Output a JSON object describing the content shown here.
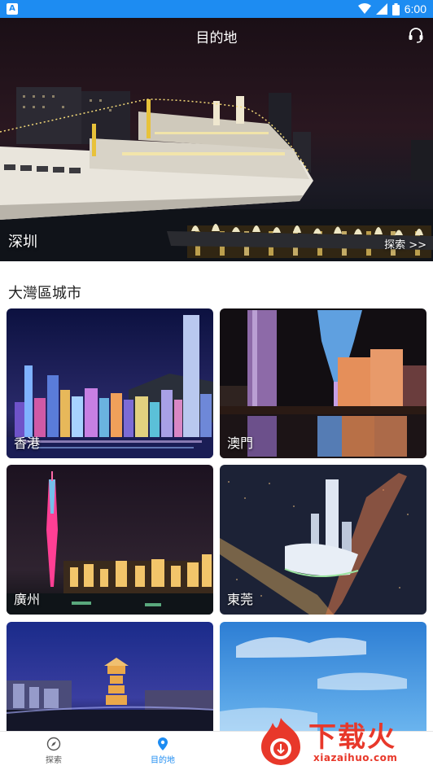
{
  "status_bar": {
    "time": "6:00",
    "notification_icon": "app-notification-icon"
  },
  "header": {
    "title": "目的地",
    "support_icon": "headset-icon"
  },
  "hero": {
    "city": "深圳",
    "explore": "探索 >>"
  },
  "section": {
    "title": "大灣區城市"
  },
  "cities": [
    {
      "name": "香港"
    },
    {
      "name": "澳門"
    },
    {
      "name": "廣州"
    },
    {
      "name": "東莞"
    },
    {
      "name": ""
    },
    {
      "name": ""
    }
  ],
  "bottom_nav": {
    "items": [
      {
        "label": "探索",
        "icon": "compass-icon",
        "active": false
      },
      {
        "label": "目的地",
        "icon": "location-pin-icon",
        "active": true
      }
    ]
  },
  "watermark": {
    "text": "下载火",
    "url": "xiazaihuo.com"
  },
  "colors": {
    "status_bar": "#1d8cf2",
    "active_nav": "#1d8cf2",
    "inactive_nav": "#555555",
    "watermark": "#e8382a"
  }
}
